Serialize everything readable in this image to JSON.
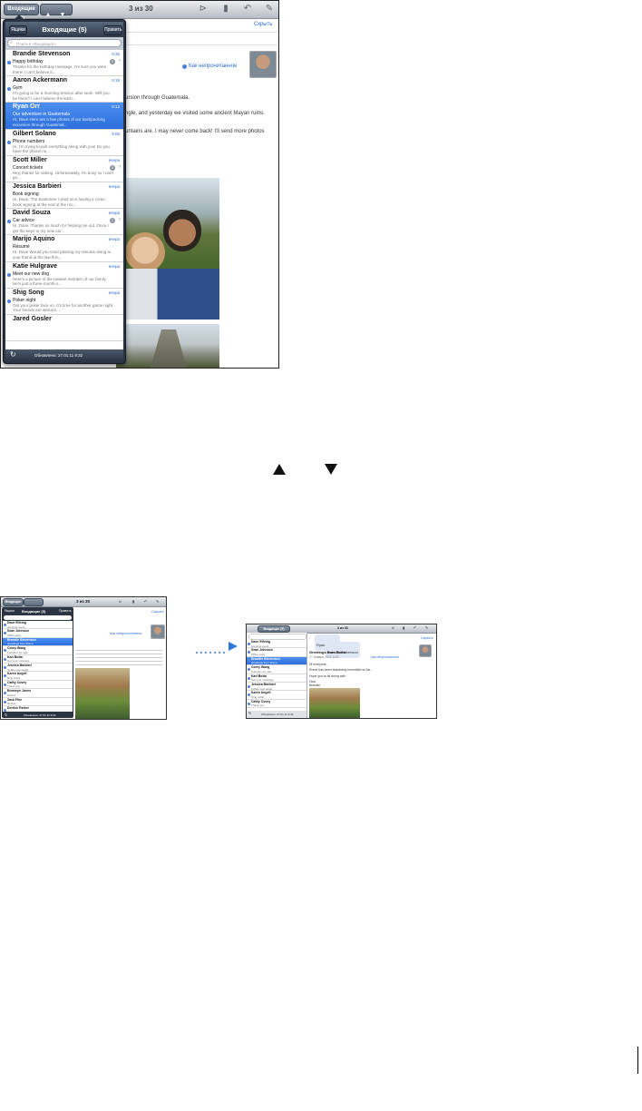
{
  "top_screen": {
    "toolbar": {
      "inbox_button": "Входящие (5)",
      "counter": "3 из 30",
      "icons": [
        "up-arrow-icon",
        "down-arrow-icon",
        "folder-icon",
        "trash-icon",
        "reply-icon",
        "compose-icon"
      ]
    },
    "hide_label": "Скрыть",
    "mark_unread": "Как непрочитанное",
    "body_lines": [
      "ursion through Guatemala.",
      "ngle, and yesterday we visited some ancient Mayan ruins.",
      "untains are. I may never come back! I'll send more photos"
    ],
    "popover": {
      "accounts_button": "Ящики",
      "title": "Входящие (5)",
      "edit_button": "Править",
      "search_placeholder": "Поиск в «Входящие»",
      "footer": "Обновлено: 27.01.11 9:32",
      "messages": [
        {
          "from": "Brandie Stevenson",
          "time": "9:25",
          "subject": "Happy birthday",
          "preview": "Thanks for the birthday message. I'm sure you were there! I can't believe it...",
          "unread": true,
          "badge": "3",
          "selected": false
        },
        {
          "from": "Aaron Ackermann",
          "time": "9:16",
          "subject": "Gym",
          "preview": "I'm going to for a morning session after work. Will you be there? I can't believe the kitch...",
          "unread": true,
          "badge": "",
          "selected": false
        },
        {
          "from": "Ryan Orr",
          "time": "9:12",
          "subject": "Our adventure in Guatemala",
          "preview": "Hi, Dave Here are a few photos of our backpacking excursion through Guatemal...",
          "unread": false,
          "badge": "",
          "selected": true
        },
        {
          "from": "Gilbert Solano",
          "time": "9:05",
          "subject": "Phone numbers",
          "preview": "Hi, I'm trying to pull everything along with you! Do you have the phone nu...",
          "unread": true,
          "badge": "",
          "selected": false
        },
        {
          "from": "Scott Miller",
          "time": "вчера",
          "subject": "Concert tickets",
          "preview": "Hey, thanks for asking. Unfortunately, I'm busy so I can't go...",
          "unread": false,
          "badge": "5",
          "selected": false
        },
        {
          "from": "Jessica Barbieri",
          "time": "вчера",
          "subject": "Book signing",
          "preview": "Hi, Dave, The bookstore I work at is having a comic book signing at the end of the mo...",
          "unread": false,
          "badge": "",
          "selected": false
        },
        {
          "from": "David Souza",
          "time": "вчера",
          "subject": "Car advice",
          "preview": "Hi, Dave. Thanks so much for helping me out. Once I get the keys to my new car...",
          "unread": true,
          "badge": "2",
          "selected": false
        },
        {
          "from": "Marijo Aquino",
          "time": "вчера",
          "subject": "Résumé",
          "preview": "Hi, Dave Would you mind passing my résumé along to your friend at the law firm...",
          "unread": false,
          "badge": "",
          "selected": false
        },
        {
          "from": "Katie Hulgrave",
          "time": "вчера",
          "subject": "Meet our new dog",
          "preview": "Here's a picture of the newest member of our family. He's just a three-month-o...",
          "unread": true,
          "badge": "",
          "selected": false
        },
        {
          "from": "Shig Song",
          "time": "вчера",
          "subject": "Poker night",
          "preview": "Get your poker face on. It's time for another game night. Your friends are welcom...",
          "unread": true,
          "badge": "",
          "selected": false
        },
        {
          "from": "Jared Gosler",
          "time": "",
          "subject": "",
          "preview": "",
          "unread": false,
          "badge": "",
          "selected": false
        }
      ]
    }
  },
  "arrows": {
    "up": "▲",
    "down": "▼"
  },
  "small_left": {
    "inbox_button": "Входящие",
    "counter": "3 из 30",
    "accounts_button": "Ящики",
    "title": "Входящие (5)",
    "edit_button": "Править",
    "hide_label": "Скрыть",
    "mark_unread": "Как непрочитанное",
    "footer": "Обновлено: 27.01.11 9:32",
    "messages": [
      {
        "from": "Dave Elfving",
        "subject": "Campus event",
        "selected": false
      },
      {
        "from": "Sean Johnson",
        "subject": "Office party",
        "selected": false
      },
      {
        "from": "Brandie Stevenson",
        "subject": "Greetings from Rome",
        "selected": true
      },
      {
        "from": "Corey Wang",
        "subject": "Furniture for sale",
        "selected": false
      },
      {
        "from": "Karl Botta",
        "subject": "Got your message",
        "selected": false
      },
      {
        "from": "Jessica Barbieri",
        "subject": "Coffee next week",
        "selected": false
      },
      {
        "from": "Karen Angell",
        "subject": "Ring outlet",
        "selected": false
      },
      {
        "from": "Cathy Covey",
        "subject": "Thank you",
        "selected": false
      },
      {
        "from": "Bronwyn Jones",
        "subject": "Haircut",
        "selected": false
      },
      {
        "from": "Zack Fine",
        "subject": "Recipe",
        "selected": false
      },
      {
        "from": "Derrick Parker",
        "subject": "",
        "selected": false
      }
    ]
  },
  "small_right": {
    "inbox_button": "Входящие (5)",
    "counter": "3 из 30",
    "from_name": "Ryan Alvarez",
    "to_name": "Brandie Stevenson",
    "hide_label": "Скрыть",
    "subject": "Greetings from Rome",
    "date": "27 января 2011 9:32",
    "mark_unread": "Как непрочитанное",
    "body": [
      "Hi everyone,",
      "Rome has been absolutely incredible so far...",
      "Hope you're all doing well.",
      "Ciao,",
      "Brandie"
    ],
    "footer": "Обновлено: 27.01.11 9:32",
    "messages": [
      {
        "from": "Dave Elfving",
        "subject": "Campus event",
        "selected": false
      },
      {
        "from": "Sean Johnson",
        "subject": "Office party",
        "selected": false
      },
      {
        "from": "Brandie Stevenson",
        "subject": "Greetings from Rome",
        "selected": true
      },
      {
        "from": "Corey Wang",
        "subject": "Furniture for sale",
        "selected": false
      },
      {
        "from": "Karl Botta",
        "subject": "Got your message",
        "selected": false
      },
      {
        "from": "Jessica Barbieri",
        "subject": "Coffee next week",
        "selected": false
      },
      {
        "from": "Karen Angell",
        "subject": "Ring outlet",
        "selected": false
      },
      {
        "from": "Cathy Covey",
        "subject": "Thank you",
        "selected": false
      }
    ]
  },
  "colors": {
    "accent": "#2f6fd1",
    "popover": "#2b3443",
    "selection": "#3a7fe6"
  }
}
